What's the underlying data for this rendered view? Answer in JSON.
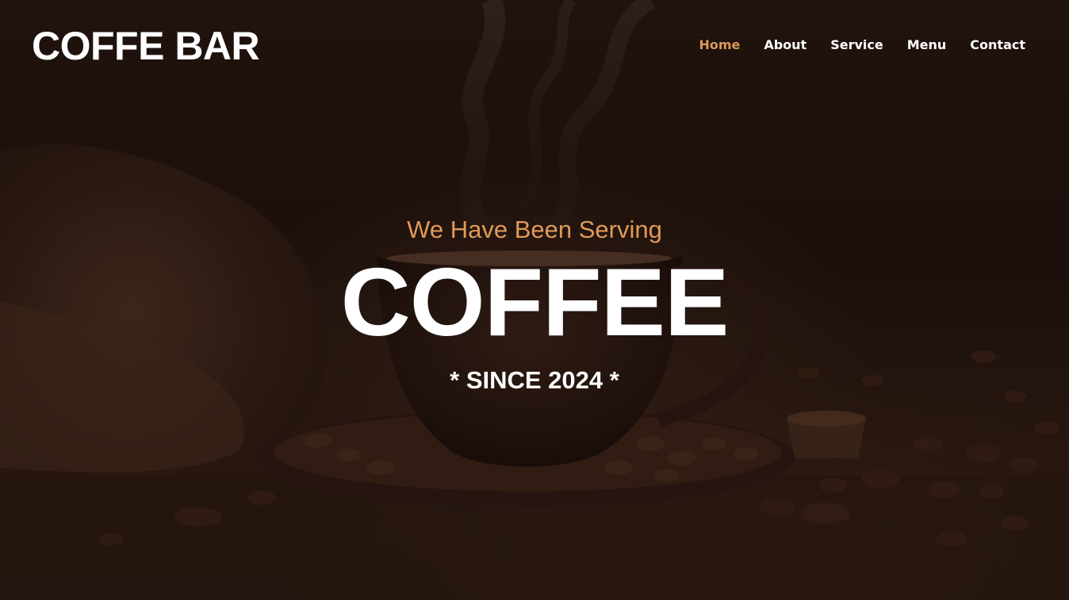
{
  "brand": {
    "logo_text": "COFFE BAR"
  },
  "nav": {
    "items": [
      {
        "label": "Home",
        "active": true
      },
      {
        "label": "About",
        "active": false
      },
      {
        "label": "Service",
        "active": false
      },
      {
        "label": "Menu",
        "active": false
      },
      {
        "label": "Contact",
        "active": false
      }
    ]
  },
  "hero": {
    "tagline": "We Have Been Serving",
    "headline": "COFFEE",
    "since": "* SINCE 2024 *",
    "background_image": "coffee-cup-steam-beans-photo"
  },
  "colors": {
    "accent": "#e09a57",
    "text": "#ffffff",
    "background": "#1f130e"
  }
}
